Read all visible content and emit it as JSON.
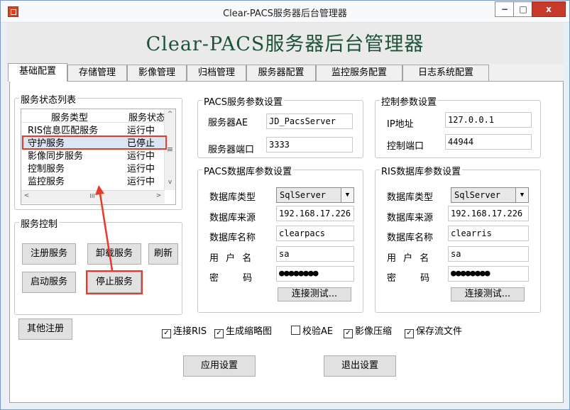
{
  "window": {
    "title": "Clear-PACS服务器后台管理器",
    "min": "−",
    "max": "□",
    "close": "x"
  },
  "header": {
    "title": "Clear-PACS服务器后台管理器"
  },
  "tabs": [
    "基础配置",
    "存储管理",
    "影像管理",
    "归档管理",
    "服务器配置",
    "监控服务配置",
    "日志系统配置"
  ],
  "service_list": {
    "group_title": "服务状态列表",
    "columns": [
      "服务类型",
      "服务状态"
    ],
    "rows": [
      {
        "type": "RIS信息匹配服务",
        "status": "运行中"
      },
      {
        "type": "守护服务",
        "status": "已停止"
      },
      {
        "type": "影像同步服务",
        "status": "运行中"
      },
      {
        "type": "控制服务",
        "status": "运行中"
      },
      {
        "type": "监控服务",
        "status": "运行中"
      }
    ],
    "scroll_up": "^",
    "scroll_down": "v",
    "scroll_grip": "≡",
    "scroll_left": "<",
    "scroll_right": ">",
    "hscroll_grip": "III"
  },
  "service_control": {
    "group_title": "服务控制",
    "register": "注册服务",
    "uninstall": "卸载服务",
    "refresh": "刷新",
    "start": "启动服务",
    "stop": "停止服务"
  },
  "pacs_params": {
    "group_title": "PACS服务参数设置",
    "ae_label": "服务器AE",
    "ae_value": "JD_PacsServer",
    "port_label": "服务器端口",
    "port_value": "3333"
  },
  "control_params": {
    "group_title": "控制参数设置",
    "ip_label": "IP地址",
    "ip_value": "127.0.0.1",
    "port_label": "控制端口",
    "port_value": "44944"
  },
  "pacs_db": {
    "group_title": "PACS数据库参数设置",
    "type_label": "数据库类型",
    "type_value": "SqlServer",
    "source_label": "数据库来源",
    "source_value": "192.168.17.226",
    "name_label": "数据库名称",
    "name_value": "clearpacs",
    "user_label": "用 户 名",
    "user_value": "sa",
    "pwd_label": "密  码",
    "pwd_value": "●●●●●●●●",
    "test_button": "连接测试..."
  },
  "ris_db": {
    "group_title": "RIS数据库参数设置",
    "type_label": "数据库类型",
    "type_value": "SqlServer",
    "source_label": "数据库来源",
    "source_value": "192.168.17.226",
    "name_label": "数据库名称",
    "name_value": "clearris",
    "user_label": "用 户 名",
    "user_value": "sa",
    "pwd_label": "密  码",
    "pwd_value": "●●●●●●●●",
    "test_button": "连接测试..."
  },
  "other_register": "其他注册",
  "checkboxes": [
    {
      "label": "连接RIS",
      "checked": true
    },
    {
      "label": "生成缩略图",
      "checked": true
    },
    {
      "label": "校验AE",
      "checked": false
    },
    {
      "label": "影像压缩",
      "checked": true
    },
    {
      "label": "保存流文件",
      "checked": true
    }
  ],
  "apply_button": "应用设置",
  "exit_button": "退出设置",
  "colors": {
    "annotation_red": "#e8392c",
    "title_green": "#1d5438",
    "selection": "#dbe6f5"
  }
}
